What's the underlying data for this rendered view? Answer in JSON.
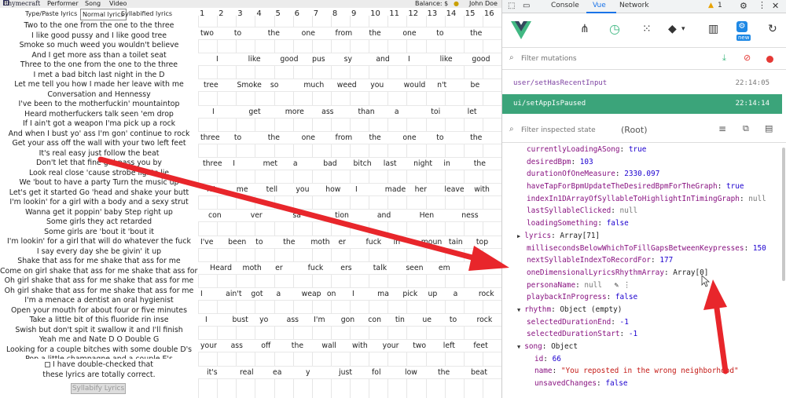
{
  "topbar": {
    "logo": "Rhymecraft",
    "performer": "Performer",
    "song": "Song",
    "video": "Video",
    "balance": "Balance: $",
    "user": "John Doe"
  },
  "tabs": [
    "Type/Paste lyrics",
    "Normal lyrics",
    "Syllabified lyrics"
  ],
  "lyrics": [
    "Two to the one from the one to the three",
    "I like good pussy and I like good tree",
    "Smoke so much weed you wouldn't believe",
    "And I get more ass than a toilet seat",
    "Three to the one from the one to the three",
    "I met a bad bitch last night in the D",
    "Let me tell you how I made her leave with me",
    "Conversation and Hennessy",
    "I've been to the motherfuckin' mountaintop",
    "Heard motherfuckers talk seen 'em drop",
    "If I ain't got a weapon I'ma pick up a rock",
    "And when I bust yo' ass I'm gon' continue to rock",
    "Get your ass off the wall with your two left feet",
    "It's real easy just follow the beat",
    "Don't let that fine girl pass you by",
    "Look real close 'cause strobe lights lie",
    "We 'bout to have a party Turn the music up",
    "Let's get it started Go 'head and shake your butt",
    "I'm lookin' for a girl with a body and a sexy strut",
    "Wanna get it poppin' baby Step right up",
    "Some girls they act retarded",
    "Some girls are 'bout it 'bout it",
    "I'm lookin' for a girl that will do whatever the fuck",
    "I say every day she be givin' it up",
    "Shake that ass for me shake that ass for me",
    "Come on girl shake that ass for me shake that ass for me",
    "Oh girl shake that ass for me shake that ass for me",
    "Oh girl shake that ass for me shake that ass for me",
    "I'm a menace a dentist an oral hygienist",
    "Open your mouth for about four or five minutes",
    "Take a little bit of this fluoride rin inse",
    "Swish but don't spit it swallow it and I'll finish",
    "Yeah me and Nate D O Double G",
    "Looking for a couple bitches with some double D's",
    "Pop a little champagne and a couple E's"
  ],
  "confirm": {
    "line1": "I have double-checked that",
    "line2": "these lyrics are totally correct.",
    "button": "Syllabify Lyrics"
  },
  "grid": {
    "headers": [
      "1",
      "2",
      "3",
      "4",
      "5",
      "6",
      "7",
      "8",
      "9",
      "10",
      "11",
      "12",
      "13",
      "14",
      "15",
      "16"
    ],
    "rows": [
      [
        "two",
        "to",
        "the",
        "one",
        "from",
        "the",
        "one",
        "to",
        "the"
      ],
      [
        "I",
        "like",
        "good",
        "pus",
        "sy",
        "and",
        "I",
        "like",
        "good"
      ],
      [
        "tree",
        "Smoke",
        "so",
        "much",
        "weed",
        "you",
        "would",
        "n't",
        "be"
      ],
      [
        "I",
        "get",
        "more",
        "ass",
        "than",
        "a",
        "toi",
        "let"
      ],
      [
        "three",
        "to",
        "the",
        "one",
        "from",
        "the",
        "one",
        "to",
        "the"
      ],
      [
        "three",
        "I",
        "met",
        "a",
        "bad",
        "bitch",
        "last",
        "night",
        "in",
        "the"
      ],
      [
        "let",
        "me",
        "tell",
        "you",
        "how",
        "I",
        "made",
        "her",
        "leave",
        "with"
      ],
      [
        "con",
        "ver",
        "sa",
        "tion",
        "and",
        "Hen",
        "ness"
      ],
      [
        "I've",
        "been",
        "to",
        "the",
        "moth",
        "er",
        "fuck",
        "in",
        "moun",
        "tain",
        "top"
      ],
      [
        "Heard",
        "moth",
        "er",
        "fuck",
        "ers",
        "talk",
        "seen",
        "em",
        "dr"
      ],
      [
        "I",
        "ain't",
        "got",
        "a",
        "weap",
        "on",
        "I",
        "ma",
        "pick",
        "up",
        "a",
        "rock"
      ],
      [
        "I",
        "bust",
        "yo",
        "ass",
        "I'm",
        "gon",
        "con",
        "tin",
        "ue",
        "to",
        "rock"
      ],
      [
        "your",
        "ass",
        "off",
        "the",
        "wall",
        "with",
        "your",
        "two",
        "left",
        "feet"
      ],
      [
        "it's",
        "real",
        "ea",
        "y",
        "just",
        "fol",
        "low",
        "the",
        "beat"
      ]
    ]
  },
  "devtools": {
    "tabs": [
      "Console",
      "Vue",
      "Network"
    ],
    "warnings": "1",
    "new_badge": "new",
    "mutation_filter_placeholder": "Filter mutations",
    "mutations": [
      {
        "name": "user/setHasRecentInput",
        "time": "22:14:05"
      },
      {
        "name": "ui/setAppIsPaused",
        "time": "22:14:14"
      }
    ],
    "inspect_placeholder": "Filter inspected state",
    "root": "(Root)",
    "state": [
      {
        "key": "currentlyLoadingASong",
        "val": "true",
        "kind": "n"
      },
      {
        "key": "desiredBpm",
        "val": "103",
        "kind": "n"
      },
      {
        "key": "durationOfOneMeasure",
        "val": "2330.097",
        "kind": "n"
      },
      {
        "key": "haveTapForBpmUpdateTheDesiredBpmForTheGraph",
        "val": "true",
        "kind": "n"
      },
      {
        "key": "indexIn1DArrayOfSyllableToHighlightInTimingGraph",
        "val": "null",
        "kind": "g"
      },
      {
        "key": "lastSyllableClicked",
        "val": "null",
        "kind": "g"
      },
      {
        "key": "loadingSomething",
        "val": "false",
        "kind": "n"
      },
      {
        "key": "lyrics",
        "val": "Array[71]",
        "kind": "t",
        "arrow": "right"
      },
      {
        "key": "millisecondsBelowWhichToFillGapsBetweenKeypresses",
        "val": "150",
        "kind": "n"
      },
      {
        "key": "nextSyllableIndexToRecordFor",
        "val": "177",
        "kind": "n"
      },
      {
        "key": "oneDimensionalLyricsRhythmArray",
        "val": "Array[0]",
        "kind": "t"
      },
      {
        "key": "personaName",
        "val": "null",
        "kind": "g"
      },
      {
        "key": "playbackInProgress",
        "val": "false",
        "kind": "n"
      },
      {
        "key": "rhythm",
        "val": "Object (empty)",
        "kind": "t",
        "arrow": "down"
      },
      {
        "key": "selectedDurationEnd",
        "val": "-1",
        "kind": "n"
      },
      {
        "key": "selectedDurationStart",
        "val": "-1",
        "kind": "n"
      },
      {
        "key": "song",
        "val": "Object",
        "kind": "t",
        "arrow": "down"
      },
      {
        "key": "id",
        "val": "66",
        "kind": "n",
        "indent": true
      },
      {
        "key": "name",
        "val": "\"You reposted in the wrong neighborhood\"",
        "kind": "s",
        "indent": true
      },
      {
        "key": "unsavedChanges",
        "val": "false",
        "kind": "n",
        "indent": true
      }
    ]
  },
  "colors": {
    "vue_green": "#41b883",
    "arrow_red": "#e8262b",
    "active_mutation": "#3ba47a"
  }
}
